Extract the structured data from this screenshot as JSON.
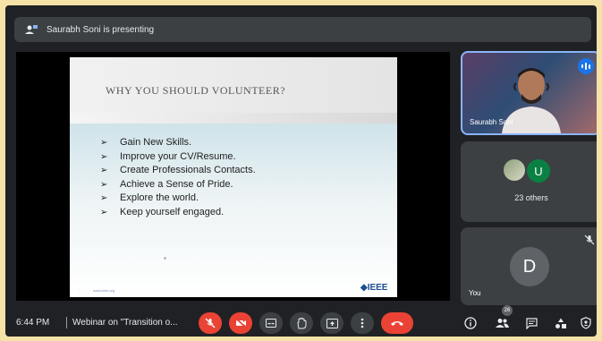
{
  "banner": {
    "text": "Saurabh Soni is presenting"
  },
  "slide": {
    "title": "WHY YOU SHOULD VOLUNTEER?",
    "bullet_marker": "➢",
    "bullets": [
      "Gain New Skills.",
      "Improve your CV/Resume.",
      "Create Professionals Contacts.",
      "Achieve a Sense of Pride.",
      "Explore the world.",
      "Keep yourself engaged."
    ],
    "footer_url": "www.ieee.org",
    "footer_mark": "·",
    "logo": "◆IEEE"
  },
  "participants": {
    "presenter_name": "Saurabh Soni",
    "group_initial": "U",
    "others_label": "23 others",
    "self_initial": "D",
    "self_label": "You"
  },
  "bottom_bar": {
    "time": "6:44 PM",
    "meeting_name": "Webinar on \"Transition o...",
    "people_count": "26"
  },
  "colors": {
    "mic_off": "#ea4335",
    "end_call": "#ea4335",
    "speaking_indicator": "#1a73e8",
    "control_bg": "#3c4043"
  }
}
